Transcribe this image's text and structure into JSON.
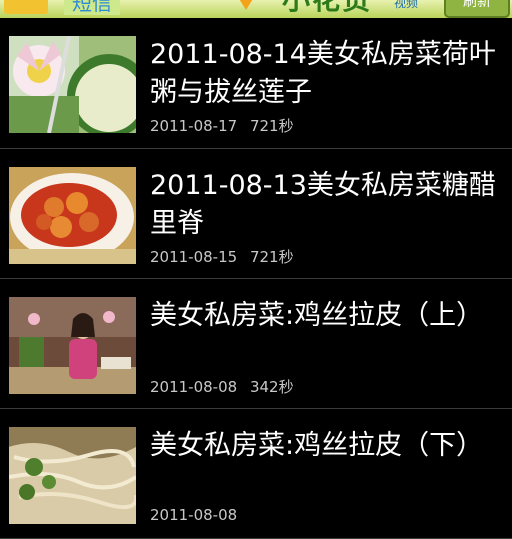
{
  "header": {
    "sms_label": "短信",
    "brand": "小花货",
    "brand_sub": "视频",
    "refresh_label": "刷新"
  },
  "videos": [
    {
      "title": "2011-08-14美女私房菜荷叶粥与拔丝莲子",
      "date": "2011-08-17",
      "duration": "721秒",
      "thumb": "lotus-porridge"
    },
    {
      "title": "2011-08-13美女私房菜糖醋里脊",
      "date": "2011-08-15",
      "duration": "721秒",
      "thumb": "sweet-sour-pork"
    },
    {
      "title": "美女私房菜:鸡丝拉皮（上）",
      "date": "2011-08-08",
      "duration": "342秒",
      "thumb": "chef-kitchen"
    },
    {
      "title": "美女私房菜:鸡丝拉皮（下）",
      "date": "2011-08-08",
      "duration": "",
      "thumb": "chicken-noodles"
    }
  ]
}
